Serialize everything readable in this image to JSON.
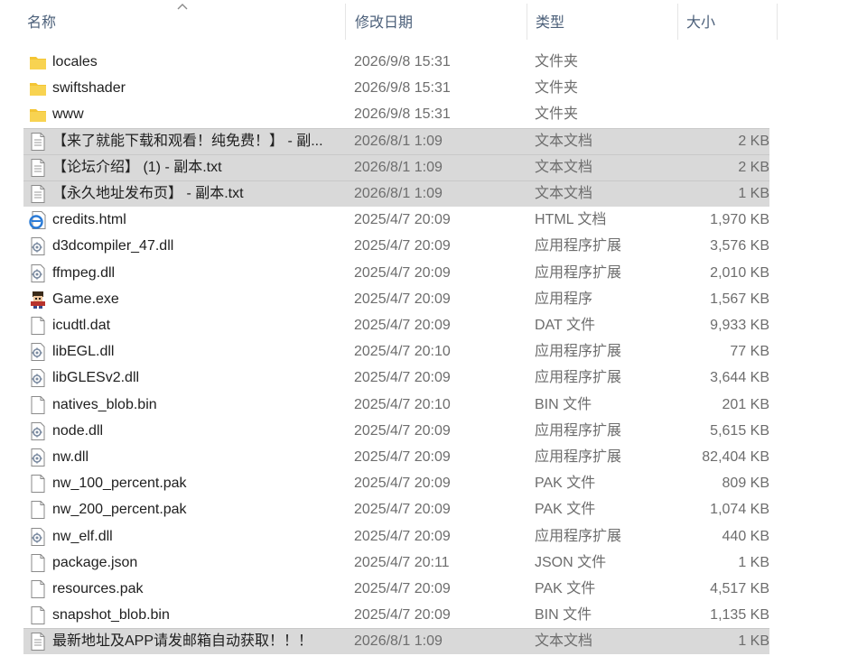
{
  "header": {
    "col_name": "名称",
    "col_date": "修改日期",
    "col_type": "类型",
    "col_size": "大小"
  },
  "files": [
    {
      "name": "locales",
      "date": "2026/9/8 15:31",
      "type": "文件夹",
      "size": "",
      "icon": "folder-icon",
      "selected": false
    },
    {
      "name": "swiftshader",
      "date": "2026/9/8 15:31",
      "type": "文件夹",
      "size": "",
      "icon": "folder-icon",
      "selected": false
    },
    {
      "name": "www",
      "date": "2026/9/8 15:31",
      "type": "文件夹",
      "size": "",
      "icon": "folder-icon",
      "selected": false
    },
    {
      "name": "【来了就能下载和观看！纯免费！】 - 副...",
      "date": "2026/8/1 1:09",
      "type": "文本文档",
      "size": "2 KB",
      "icon": "text-file-icon",
      "selected": true
    },
    {
      "name": "【论坛介绍】 (1) - 副本.txt",
      "date": "2026/8/1 1:09",
      "type": "文本文档",
      "size": "2 KB",
      "icon": "text-file-icon",
      "selected": true
    },
    {
      "name": "【永久地址发布页】 - 副本.txt",
      "date": "2026/8/1 1:09",
      "type": "文本文档",
      "size": "1 KB",
      "icon": "text-file-icon",
      "selected": true
    },
    {
      "name": "credits.html",
      "date": "2025/4/7 20:09",
      "type": "HTML 文档",
      "size": "1,970 KB",
      "icon": "html-file-icon",
      "selected": false
    },
    {
      "name": "d3dcompiler_47.dll",
      "date": "2025/4/7 20:09",
      "type": "应用程序扩展",
      "size": "3,576 KB",
      "icon": "dll-file-icon",
      "selected": false
    },
    {
      "name": "ffmpeg.dll",
      "date": "2025/4/7 20:09",
      "type": "应用程序扩展",
      "size": "2,010 KB",
      "icon": "dll-file-icon",
      "selected": false
    },
    {
      "name": "Game.exe",
      "date": "2025/4/7 20:09",
      "type": "应用程序",
      "size": "1,567 KB",
      "icon": "game-exe-icon",
      "selected": false
    },
    {
      "name": "icudtl.dat",
      "date": "2025/4/7 20:09",
      "type": "DAT 文件",
      "size": "9,933 KB",
      "icon": "blank-file-icon",
      "selected": false
    },
    {
      "name": "libEGL.dll",
      "date": "2025/4/7 20:10",
      "type": "应用程序扩展",
      "size": "77 KB",
      "icon": "dll-file-icon",
      "selected": false
    },
    {
      "name": "libGLESv2.dll",
      "date": "2025/4/7 20:09",
      "type": "应用程序扩展",
      "size": "3,644 KB",
      "icon": "dll-file-icon",
      "selected": false
    },
    {
      "name": "natives_blob.bin",
      "date": "2025/4/7 20:10",
      "type": "BIN 文件",
      "size": "201 KB",
      "icon": "blank-file-icon",
      "selected": false
    },
    {
      "name": "node.dll",
      "date": "2025/4/7 20:09",
      "type": "应用程序扩展",
      "size": "5,615 KB",
      "icon": "dll-file-icon",
      "selected": false
    },
    {
      "name": "nw.dll",
      "date": "2025/4/7 20:09",
      "type": "应用程序扩展",
      "size": "82,404 KB",
      "icon": "dll-file-icon",
      "selected": false
    },
    {
      "name": "nw_100_percent.pak",
      "date": "2025/4/7 20:09",
      "type": "PAK 文件",
      "size": "809 KB",
      "icon": "blank-file-icon",
      "selected": false
    },
    {
      "name": "nw_200_percent.pak",
      "date": "2025/4/7 20:09",
      "type": "PAK 文件",
      "size": "1,074 KB",
      "icon": "blank-file-icon",
      "selected": false
    },
    {
      "name": "nw_elf.dll",
      "date": "2025/4/7 20:09",
      "type": "应用程序扩展",
      "size": "440 KB",
      "icon": "dll-file-icon",
      "selected": false
    },
    {
      "name": "package.json",
      "date": "2025/4/7 20:11",
      "type": "JSON 文件",
      "size": "1 KB",
      "icon": "blank-file-icon",
      "selected": false
    },
    {
      "name": "resources.pak",
      "date": "2025/4/7 20:09",
      "type": "PAK 文件",
      "size": "4,517 KB",
      "icon": "blank-file-icon",
      "selected": false
    },
    {
      "name": "snapshot_blob.bin",
      "date": "2025/4/7 20:09",
      "type": "BIN 文件",
      "size": "1,135 KB",
      "icon": "blank-file-icon",
      "selected": false
    },
    {
      "name": "最新地址及APP请发邮箱自动获取！！！",
      "date": "2026/8/1 1:09",
      "type": "文本文档",
      "size": "1 KB",
      "icon": "text-file-icon",
      "selected": true
    }
  ]
}
